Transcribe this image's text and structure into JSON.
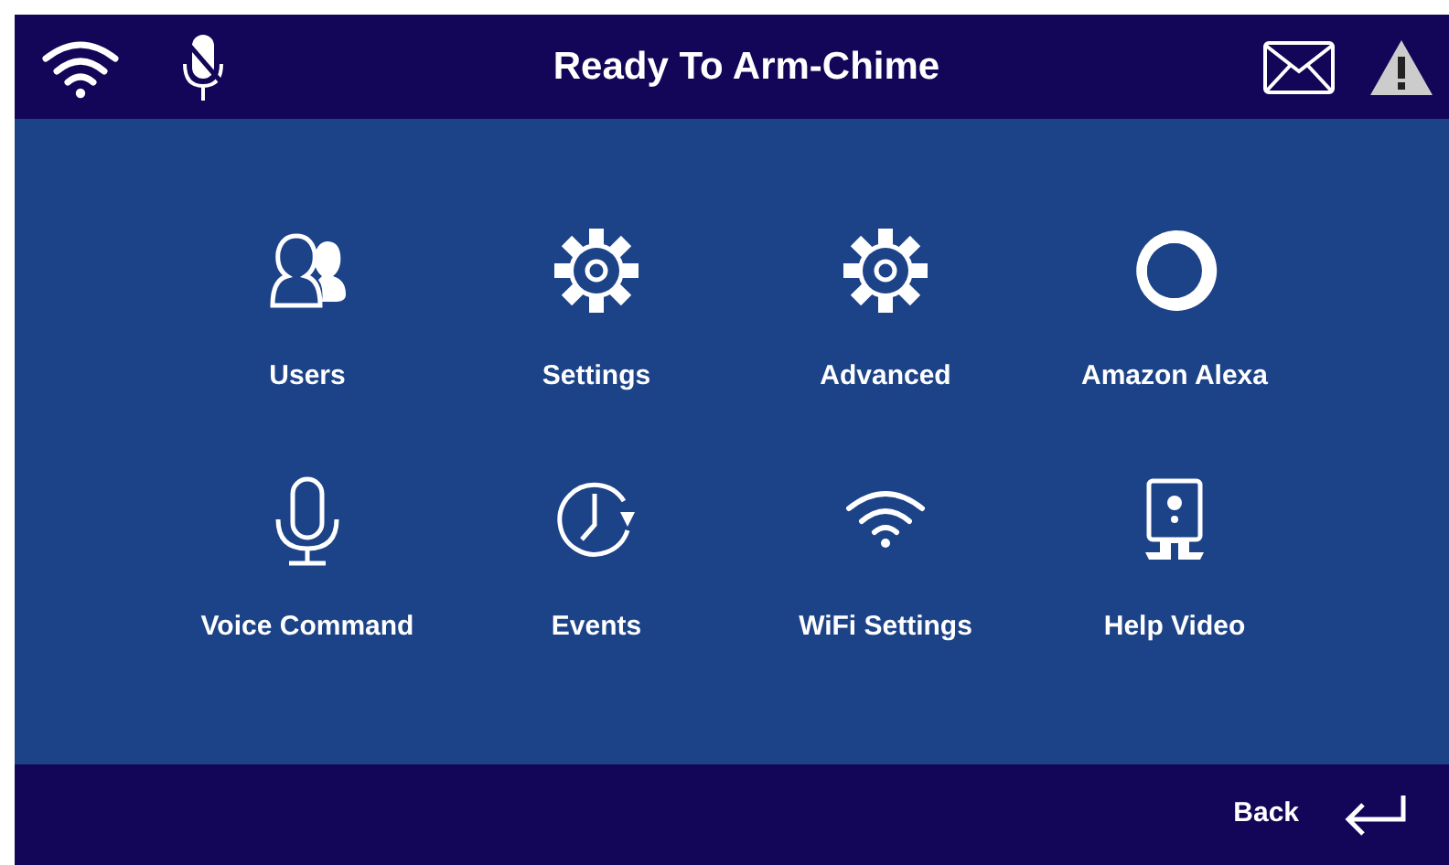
{
  "header": {
    "title": "Ready To Arm-Chime"
  },
  "tiles": [
    {
      "label": "Users",
      "kind": "users"
    },
    {
      "label": "Settings",
      "kind": "gear"
    },
    {
      "label": "Advanced",
      "kind": "gear"
    },
    {
      "label": "Amazon Alexa",
      "kind": "alexa"
    },
    {
      "label": "Voice Command",
      "kind": "mic"
    },
    {
      "label": "Events",
      "kind": "history"
    },
    {
      "label": "WiFi Settings",
      "kind": "wifi"
    },
    {
      "label": "Help Video",
      "kind": "help"
    }
  ],
  "footer": {
    "back_label": "Back"
  }
}
